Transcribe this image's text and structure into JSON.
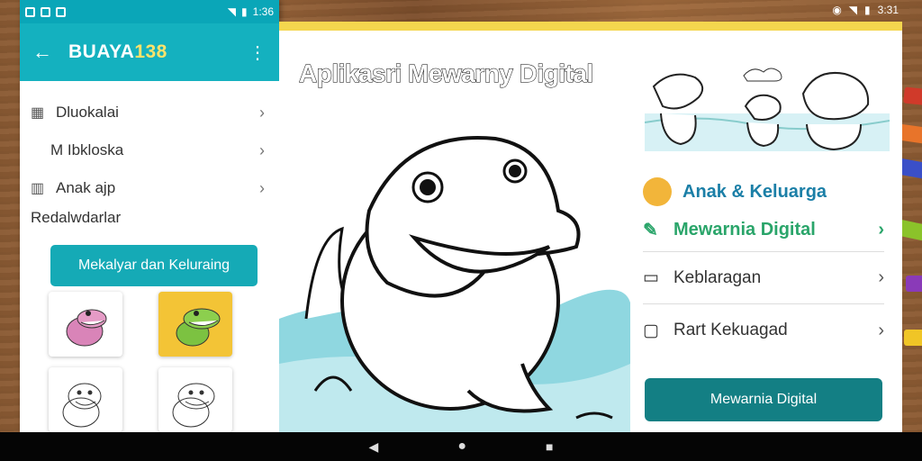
{
  "left_phone": {
    "status": {
      "time": "1:36"
    },
    "appbar": {
      "title_main": "BUAYA",
      "title_num": "138"
    },
    "menu": [
      {
        "icon": "grid-icon",
        "label": "Dluokalai"
      },
      {
        "icon": "m-icon",
        "label": "M  Ibkloska"
      },
      {
        "icon": "columns-icon",
        "label": "Anak  ajp"
      }
    ],
    "subtitle": "Redalwdarlar",
    "pill_button": "Mekalyar dan Keluraing"
  },
  "panel": {
    "title": "Aplikasri Mewarny Digital",
    "status_time": "3:31",
    "nav": {
      "item1": "Anak & Keluarga",
      "item2": "Mewarnia Digital",
      "item3": "Keblaragan",
      "item4": "Rart Kekuagad"
    },
    "bottom_button": "Mewarnia Digital"
  },
  "colors": {
    "teal": "#14b1bf",
    "teal_dark": "#137f84",
    "green": "#2aa56a",
    "blue": "#1b7fa7",
    "yellow": "#f4d64e"
  }
}
